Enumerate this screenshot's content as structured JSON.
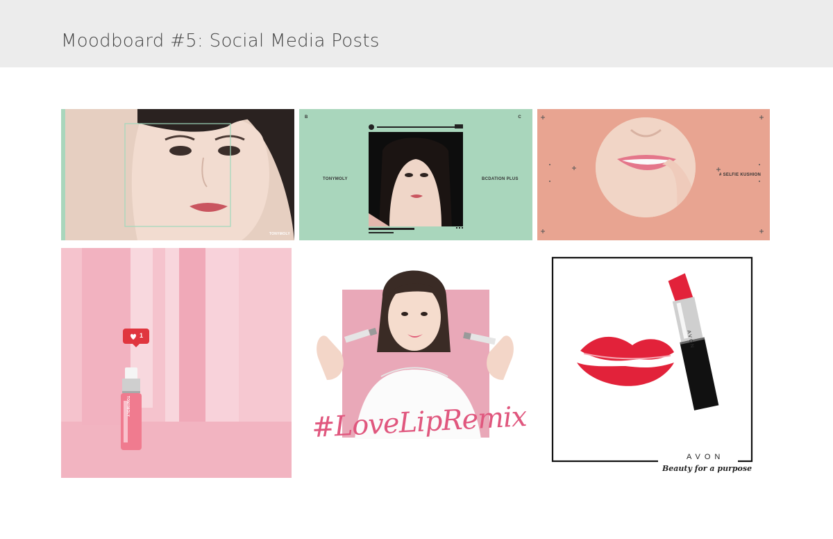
{
  "header": {
    "title": "Moodboard #5: Social Media Posts"
  },
  "colors": {
    "header_bg": "#ececec",
    "mint": "#a9d6bc",
    "salmon": "#e8a491",
    "pink": "#f3b9c6",
    "lipstick_red": "#e2223a",
    "hashtag_pink": "#e0577e"
  },
  "tiles": {
    "tile1": {
      "brand": "TONYMOLY"
    },
    "tile2": {
      "left_brand": "TONYMOLY",
      "right_text": "BCDATION PLUS",
      "corner_left": "B",
      "corner_right": "C"
    },
    "tile3": {
      "label": "# SELFIE KUSHION"
    },
    "tile4": {
      "like_count": "1",
      "bottle_brand": "TONYMOLY"
    },
    "tile5": {
      "hashtag": "#LoveLipRemix"
    },
    "tile6": {
      "lipstick_brand": "AVON",
      "brand": "AVON",
      "tagline": "Beauty for a purpose"
    }
  }
}
